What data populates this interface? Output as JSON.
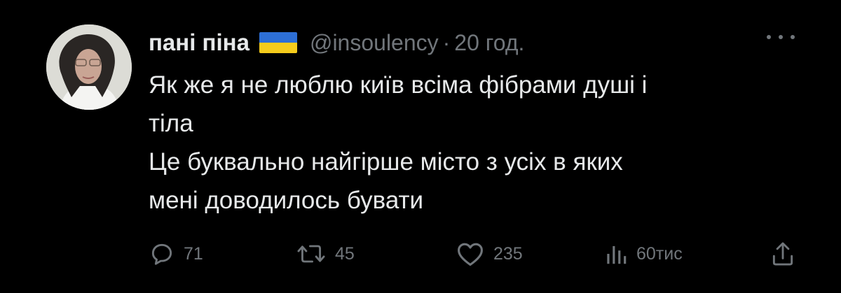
{
  "author": {
    "display_name": "пані піна",
    "flag_icon": "ukraine-flag-icon",
    "flag_colors": [
      "#2d6fd6",
      "#f5cc1c"
    ],
    "handle": "@insoulency",
    "separator": "·",
    "time": "20 год."
  },
  "more_icon": "more-dots-icon",
  "tweet": {
    "lines": [
      "Як же я не люблю київ всіма фібрами душі і",
      "тіла",
      "Це буквально найгірше місто з усіх в яких",
      "мені доводилось бувати"
    ]
  },
  "actions": {
    "replies": {
      "icon": "reply-icon",
      "count": "71"
    },
    "reposts": {
      "icon": "repost-icon",
      "count": "45"
    },
    "likes": {
      "icon": "heart-icon",
      "count": "235"
    },
    "views": {
      "icon": "views-icon",
      "count": "60тис"
    },
    "share": {
      "icon": "share-icon"
    }
  },
  "colors": {
    "background": "#000000",
    "primary_text": "#e7e9ea",
    "secondary_text": "#71767b"
  }
}
